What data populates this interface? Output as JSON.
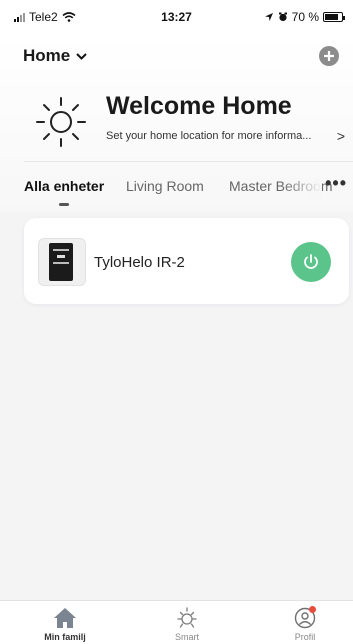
{
  "status_bar": {
    "carrier": "Tele2",
    "time": "13:27",
    "battery_text": "70 %",
    "battery_level": 0.7
  },
  "header": {
    "home_label": "Home",
    "welcome_title": "Welcome Home",
    "welcome_subtitle": "Set your home location for more informa...",
    "chevron": ">"
  },
  "tabs": [
    {
      "label": "Alla enheter",
      "active": true
    },
    {
      "label": "Living Room",
      "active": false
    },
    {
      "label": "Master Bedroom",
      "active": false
    }
  ],
  "more_label": "•••",
  "devices": [
    {
      "name": "TyloHelo IR-2",
      "power_color": "#5ac48a",
      "power_icon": "power-icon"
    }
  ],
  "tab_bar": [
    {
      "label": "Min familj",
      "icon": "home-icon",
      "active": true
    },
    {
      "label": "Smart",
      "icon": "sun-icon",
      "active": false
    },
    {
      "label": "Profil",
      "icon": "profile-icon",
      "active": false
    }
  ],
  "colors": {
    "accent_green": "#5ac48a",
    "notification_red": "#e84c3d"
  }
}
